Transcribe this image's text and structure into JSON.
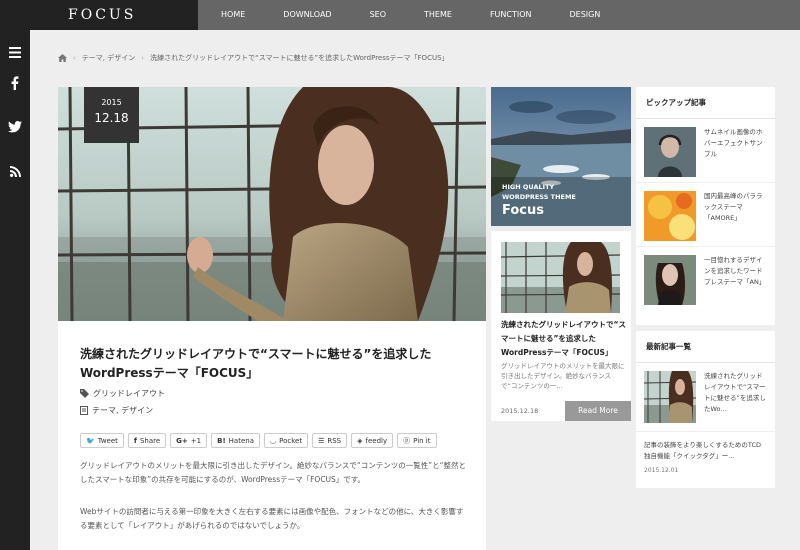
{
  "header": {
    "logo": "FOCUS",
    "nav": [
      "HOME",
      "DOWNLOAD",
      "SEO",
      "THEME",
      "FUNCTION",
      "DESIGN"
    ]
  },
  "sidebar": {
    "icons": [
      "menu-icon",
      "facebook-icon",
      "twitter-icon",
      "rss-icon"
    ]
  },
  "breadcrumb": {
    "items": [
      "テーマ, デザイン",
      "洗練されたグリッドレイアウトで“スマートに魅せる”を追求したWordPressテーマ「FOCUS」"
    ]
  },
  "article": {
    "date_year": "2015",
    "date_md": "12.18",
    "title": "洗練されたグリッドレイアウトで“スマートに魅せる”を追求したWordPressテーマ「FOCUS」",
    "tag": "グリッドレイアウト",
    "category": "テーマ, デザイン",
    "share": [
      "Tweet",
      "Share",
      "+1",
      "Hatena",
      "Pocket",
      "RSS",
      "feedly",
      "Pin it"
    ],
    "p1": "グリッドレイアウトのメリットを最大限に引き出したデザイン。絶妙なバランスで“コンテンツの一覧性”と“整然としたスマートな印象”の共存を可能にするのが、WordPressテーマ「FOCUS」です。",
    "p2": "Webサイトの訪問者に与える第一印象を大きく左右する要素には画像や配色、フォントなどの他に、大きく影響する要素として「レイアウト」があげられるのではないでしょうか。"
  },
  "featured": {
    "line1": "HIGH QUALITY",
    "line2": "WORDPRESS THEME",
    "line3": "Focus"
  },
  "card": {
    "title": "洗練されたグリッドレイアウトで“スマートに魅せる”を追求したWordPressテーマ「FOCUS」",
    "excerpt": "グリッドレイアウトのメリットを最大限に引き出したデザイン。絶妙なバランスで“コンテンツの一…",
    "date": "2015.12.18",
    "read_more": "Read More"
  },
  "pickup": {
    "heading": "ピックアップ記事",
    "items": [
      "サムネイル画像のホバーエフェクトサンプル",
      "国内最高峰のパララックステーマ「AMORE」",
      "一目惚れするデザインを追求したワードプレステーマ「AN」"
    ]
  },
  "latest": {
    "heading": "最新記事一覧",
    "items": [
      {
        "text": "洗練されたグリッドレイアウトで“スマートに魅せる”を追求したWo…",
        "date": ""
      },
      {
        "text": "記事の装飾をより楽しくするためのTCD独自機能「クイックタグ」ー…",
        "date": "2015.12.01"
      }
    ]
  }
}
